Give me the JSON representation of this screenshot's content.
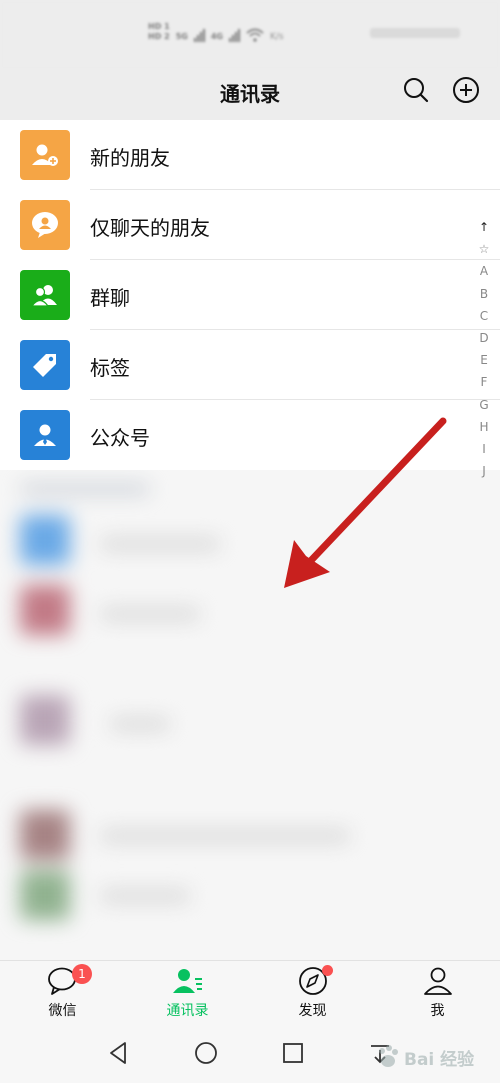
{
  "status_bar": {
    "hd1": "HD 1",
    "hd2": "HD 2",
    "net1": "5G",
    "net2": "4G",
    "speed": "K/s"
  },
  "header": {
    "title": "通讯录"
  },
  "menu": {
    "items": [
      {
        "label": "新的朋友",
        "icon": "new-friend-icon",
        "color": "#f5a545"
      },
      {
        "label": "仅聊天的朋友",
        "icon": "chat-only-friend-icon",
        "color": "#f5a545"
      },
      {
        "label": "群聊",
        "icon": "group-chat-icon",
        "color": "#1aad19"
      },
      {
        "label": "标签",
        "icon": "tag-icon",
        "color": "#2782d7"
      },
      {
        "label": "公众号",
        "icon": "official-account-icon",
        "color": "#2782d7"
      }
    ]
  },
  "index_bar": [
    "↑",
    "☆",
    "A",
    "B",
    "C",
    "D",
    "E",
    "F",
    "G",
    "H",
    "I",
    "J"
  ],
  "tab_bar": {
    "tabs": [
      {
        "label": "微信",
        "badge": "1"
      },
      {
        "label": "通讯录",
        "active": true
      },
      {
        "label": "发现",
        "dot": true
      },
      {
        "label": "我"
      }
    ],
    "active_color": "#07c160"
  },
  "watermark": {
    "text": "Bai 经验"
  }
}
